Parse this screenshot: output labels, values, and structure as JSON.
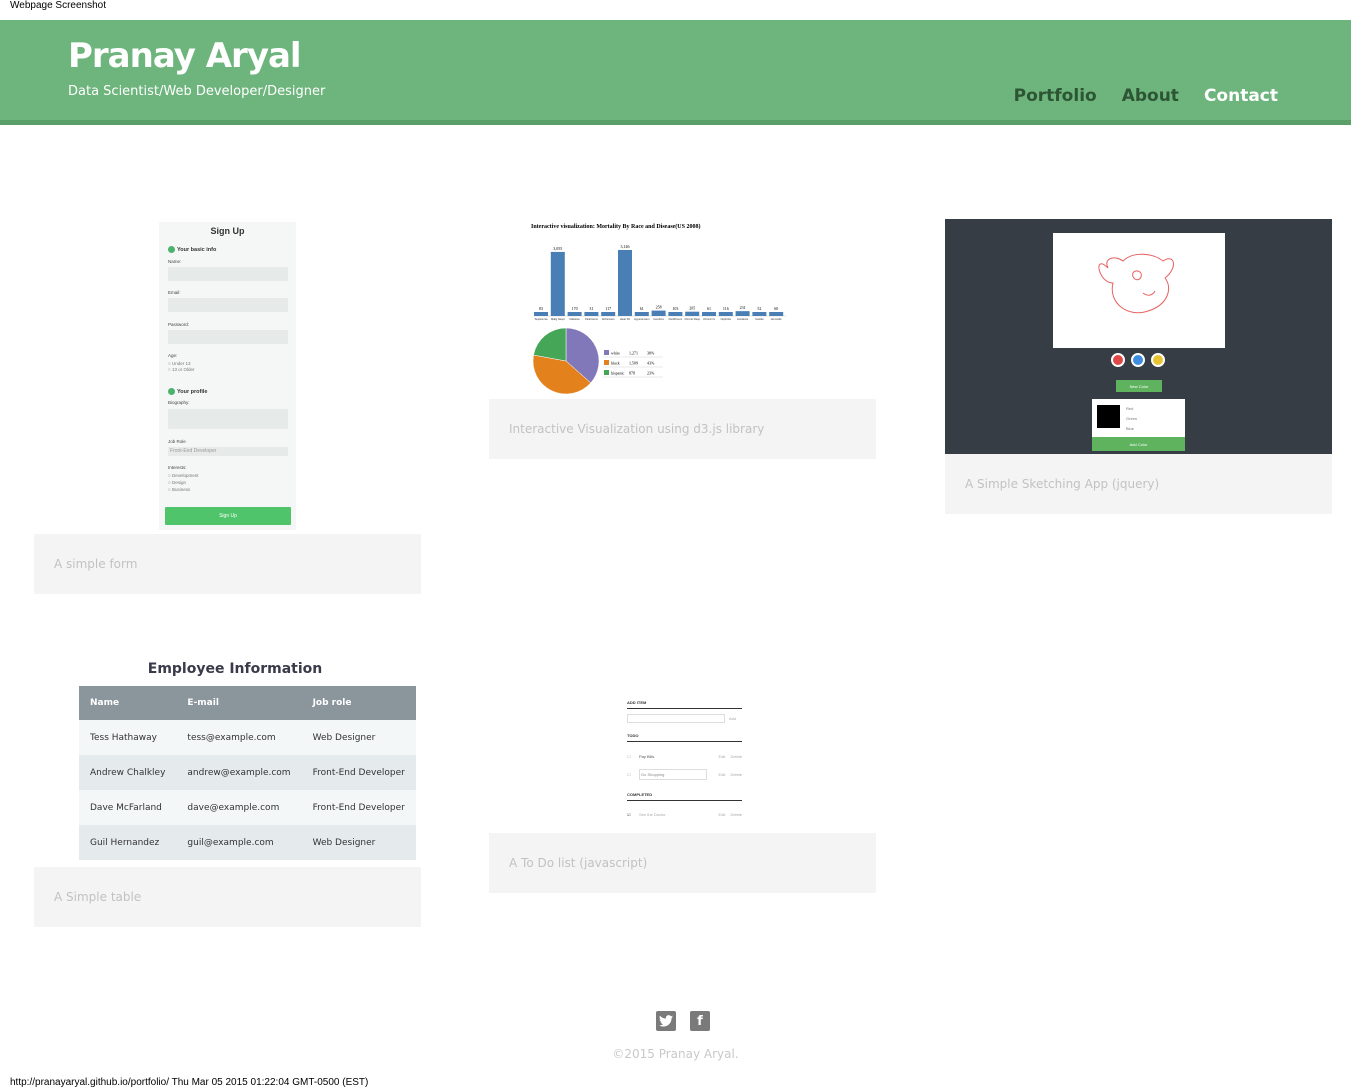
{
  "screenshot": {
    "title": "Webpage Screenshot",
    "footer": "http://pranayaryal.github.io/portfolio/ Thu Mar 05 2015 01:22:04 GMT-0500 (EST)"
  },
  "header": {
    "brand": "Pranay Aryal",
    "tagline": "Data Scientist/Web Developer/Designer",
    "nav": [
      "Portfolio",
      "About",
      "Contact"
    ]
  },
  "colors": {
    "header_green": "#6db57c",
    "nav_dark": "#2d5534",
    "caption_bg": "#f4f4f4",
    "caption_text": "#c2c2c2"
  },
  "projects": {
    "form": {
      "caption": "A simple form",
      "thumb": {
        "title": "Sign Up",
        "section1": "Your basic info",
        "name": "Name:",
        "email": "Email:",
        "password": "Password:",
        "age": "Age:",
        "age_opt1": "Under 13",
        "age_opt2": "13 or Older",
        "section2": "Your profile",
        "bio": "Biography:",
        "job_role": "Job Role",
        "job_value": "Front-End Developer",
        "interests": "Interests:",
        "interest1": "Development",
        "interest2": "Design",
        "interest3": "Business",
        "button": "Sign Up"
      }
    },
    "viz": {
      "caption": "Interactive Visualization using d3.js library",
      "thumb_title": "Interactive visualization: Mortality By Race and Disease(US 2008)"
    },
    "sketch": {
      "caption": "A Simple Sketching App (jquery)",
      "new_color": "New Color",
      "add_color": "Add Color",
      "red": "Red",
      "green": "Green",
      "blue": "Blue"
    },
    "table": {
      "caption": "A Simple table",
      "title": "Employee Information",
      "headers": [
        "Name",
        "E-mail",
        "Job role"
      ],
      "rows": [
        [
          "Tess Hathaway",
          "tess@example.com",
          "Web Designer"
        ],
        [
          "Andrew Chalkley",
          "andrew@example.com",
          "Front-End Developer"
        ],
        [
          "Dave McFarland",
          "dave@example.com",
          "Front-End Developer"
        ],
        [
          "Guil Hernandez",
          "guil@example.com",
          "Web Designer"
        ]
      ]
    },
    "todo": {
      "caption": "A To Do list (javascript)",
      "add_item": "ADD ITEM",
      "add": "Add",
      "todo": "TODO",
      "item1": "Pay Bills",
      "item2": "Go Shopping",
      "completed": "COMPLETED",
      "item3": "See the Doctor",
      "edit": "Edit",
      "delete": "Delete"
    }
  },
  "chart_data": {
    "type": "bar",
    "title": "Interactive visualization: Mortality By Race and Disease(US 2008)",
    "categories": [
      "Septicemia",
      "Malig Neopl",
      "Diabetes",
      "Parkinsons",
      "Alzheimers",
      "Heart Dz",
      "Hypertension",
      "Cerebrov",
      "Flu&Pneum",
      "Chronic Resp",
      "Chronic liv",
      "Nephritis",
      "Accidents",
      "Suicide",
      "Homicide"
    ],
    "values": [
      83,
      3055,
      170,
      31,
      117,
      3146,
      61,
      258,
      103,
      205,
      61,
      116,
      231,
      52,
      60
    ],
    "pie": [
      {
        "name": "white",
        "value": "1,271",
        "pct": "38%",
        "color": "#8078b8"
      },
      {
        "name": "black",
        "value": "1,509",
        "pct": "43%",
        "color": "#e3811d"
      },
      {
        "name": "hispanic",
        "value": "878",
        "pct": "23%",
        "color": "#45a657"
      }
    ]
  },
  "footer": {
    "twitter_icon": "twitter-icon",
    "facebook_icon": "facebook-icon",
    "copyright": "©2015 Pranay Aryal."
  }
}
